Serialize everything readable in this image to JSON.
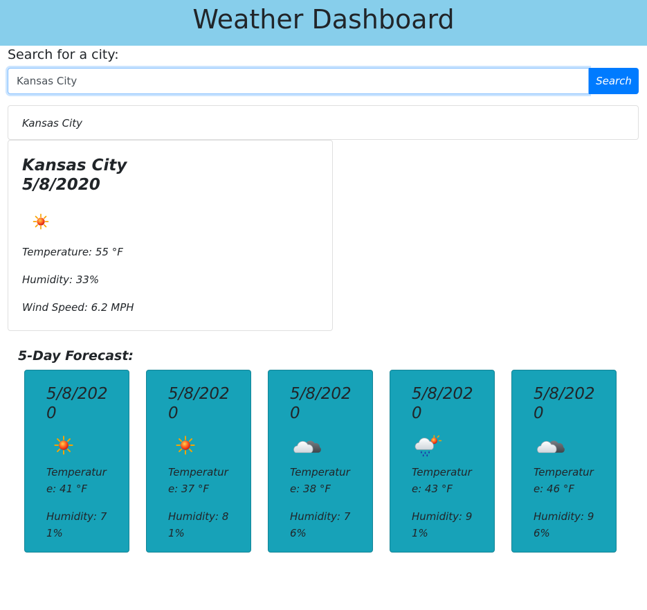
{
  "header": {
    "title": "Weather Dashboard"
  },
  "search": {
    "label": "Search for a city:",
    "value": "Kansas City",
    "button_label": "Search"
  },
  "history": [
    {
      "city": "Kansas City"
    }
  ],
  "current": {
    "city": "Kansas City",
    "date": "5/8/2020",
    "icon": "sun-icon",
    "temperature": "Temperature: 55 °F",
    "humidity": "Humidity: 33%",
    "wind": "Wind Speed: 6.2 MPH"
  },
  "forecast": {
    "title": "5-Day Forecast:",
    "days": [
      {
        "date": "5/8/2020",
        "icon": "sun-icon",
        "temp": "Temperature: 41 °F",
        "humidity": "Humidity: 71%"
      },
      {
        "date": "5/8/2020",
        "icon": "sun-icon",
        "temp": "Temperature: 37 °F",
        "humidity": "Humidity: 81%"
      },
      {
        "date": "5/8/2020",
        "icon": "broken-clouds-icon",
        "temp": "Temperature: 38 °F",
        "humidity": "Humidity: 76%"
      },
      {
        "date": "5/8/2020",
        "icon": "rain-sun-icon",
        "temp": "Temperature: 43 °F",
        "humidity": "Humidity: 91%"
      },
      {
        "date": "5/8/2020",
        "icon": "broken-clouds-icon",
        "temp": "Temperature: 46 °F",
        "humidity": "Humidity: 96%"
      }
    ]
  }
}
